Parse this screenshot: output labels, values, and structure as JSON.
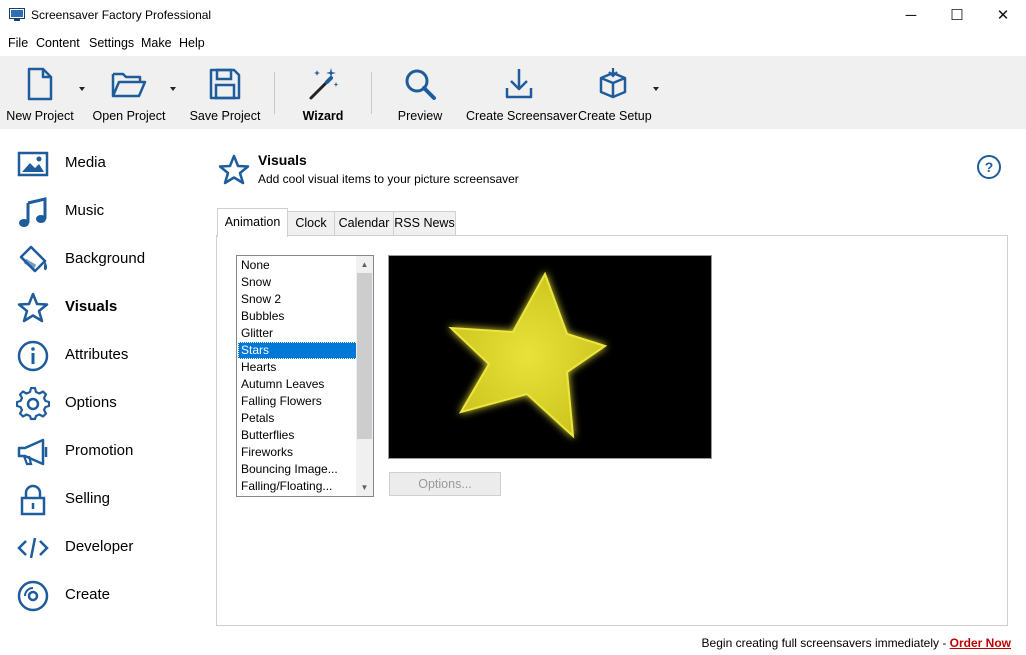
{
  "window": {
    "title": "Screensaver Factory Professional",
    "minimize": "─",
    "maximize": "☐",
    "close": "✕"
  },
  "menu": [
    "File",
    "Content",
    "Settings",
    "Make",
    "Help"
  ],
  "toolbar": {
    "new_project": "New Project",
    "open_project": "Open Project",
    "save_project": "Save Project",
    "wizard": "Wizard",
    "preview": "Preview",
    "create_screensaver": "Create Screensaver",
    "create_setup": "Create Setup"
  },
  "sidebar": {
    "items": [
      {
        "label": "Media",
        "icon": "image-icon"
      },
      {
        "label": "Music",
        "icon": "music-note-icon"
      },
      {
        "label": "Background",
        "icon": "paint-bucket-icon"
      },
      {
        "label": "Visuals",
        "icon": "star-icon",
        "active": true
      },
      {
        "label": "Attributes",
        "icon": "info-icon"
      },
      {
        "label": "Options",
        "icon": "gear-icon"
      },
      {
        "label": "Promotion",
        "icon": "megaphone-icon"
      },
      {
        "label": "Selling",
        "icon": "lock-icon"
      },
      {
        "label": "Developer",
        "icon": "code-icon"
      },
      {
        "label": "Create",
        "icon": "disc-icon"
      }
    ]
  },
  "section": {
    "title": "Visuals",
    "subtitle": "Add cool visual items to your picture screensaver",
    "help": "?"
  },
  "tabs": [
    "Animation",
    "Clock",
    "Calendar",
    "RSS News"
  ],
  "active_tab": "Animation",
  "animations": {
    "items": [
      "None",
      "Snow",
      "Snow 2",
      "Bubbles",
      "Glitter",
      "Stars",
      "Hearts",
      "Autumn Leaves",
      "Falling Flowers",
      "Petals",
      "Butterflies",
      "Fireworks",
      "Bouncing Image...",
      "Falling/Floating..."
    ],
    "selected": "Stars"
  },
  "options_button": "Options...",
  "footer": {
    "text": "Begin creating full screensavers immediately - ",
    "link": "Order Now"
  },
  "colors": {
    "accent": "#0078d7",
    "icon_blue": "#1e5c9c",
    "link_red": "#c00000",
    "star_yellow": "#e0d82a"
  }
}
